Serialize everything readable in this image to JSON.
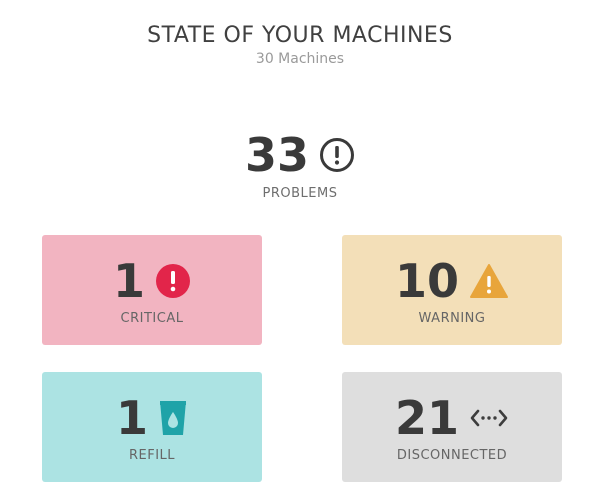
{
  "header": {
    "title": "STATE OF YOUR MACHINES",
    "subtitle": "30 Machines"
  },
  "total": {
    "count": "33",
    "label": "PROBLEMS",
    "icon": "alert-circle-icon"
  },
  "cards": {
    "critical": {
      "count": "1",
      "label": "CRITICAL",
      "icon": "exclamation-circle-icon",
      "background": "#f2b4c1",
      "icon_color": "#e2254a"
    },
    "warning": {
      "count": "10",
      "label": "WARNING",
      "icon": "warning-triangle-icon",
      "background": "#f3dfb8",
      "icon_color": "#e8a53b"
    },
    "refill": {
      "count": "1",
      "label": "REFILL",
      "icon": "cup-drop-icon",
      "background": "#ace3e3",
      "icon_color": "#1fa3a8"
    },
    "disconnected": {
      "count": "21",
      "label": "DISCONNECTED",
      "icon": "disconnected-arrows-icon",
      "background": "#dedede",
      "icon_color": "#3d3d3d"
    }
  }
}
